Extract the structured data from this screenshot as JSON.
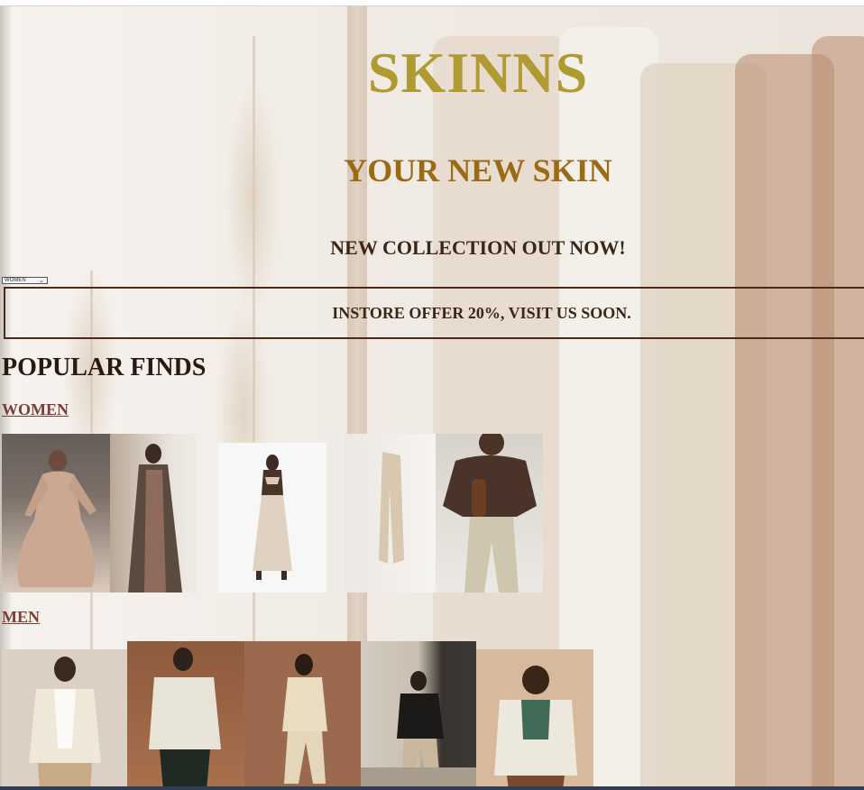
{
  "header": {
    "brand": "SKINNS",
    "tagline": "YOUR NEW SKIN",
    "announcement": "NEW COLLECTION OUT NOW!"
  },
  "category_select": {
    "selected": "WOMEN"
  },
  "offer": {
    "text": "INSTORE OFFER 20%, VISIT US SOON."
  },
  "popular": {
    "title": "POPULAR FINDS",
    "women_label": "WOMEN",
    "men_label": "MEN"
  },
  "colors": {
    "brand": "#b09a32",
    "tagline": "#9a6a14",
    "link": "#7a3f34",
    "offer_border": "#4a2a18"
  }
}
